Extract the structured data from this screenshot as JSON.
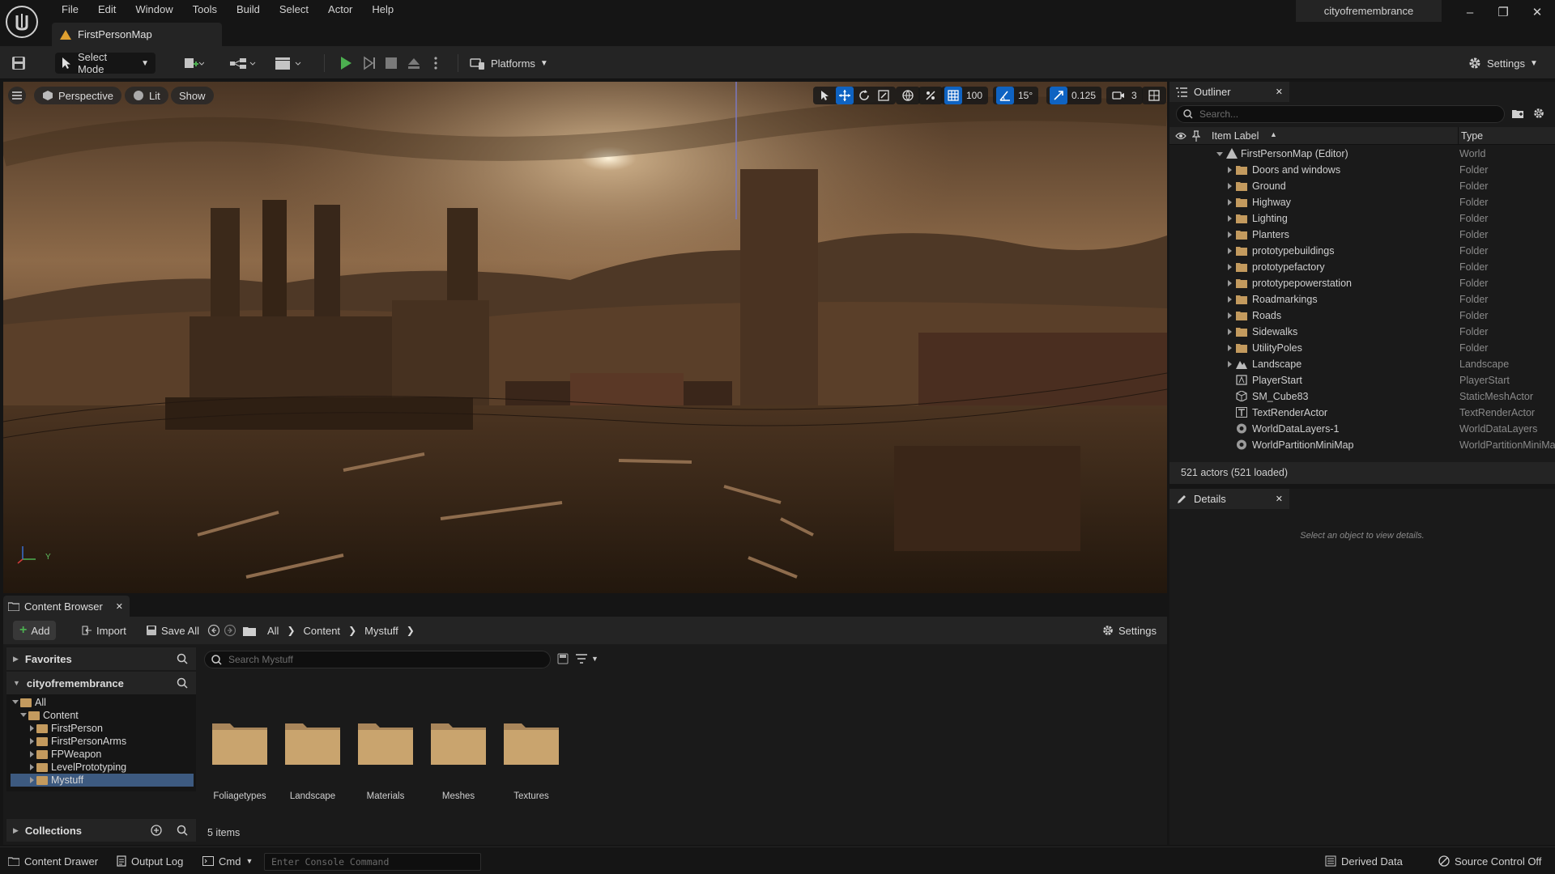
{
  "menu": [
    "File",
    "Edit",
    "Window",
    "Tools",
    "Build",
    "Select",
    "Actor",
    "Help"
  ],
  "map_tab": "FirstPersonMap",
  "project_name": "cityofremembrance",
  "toolbar": {
    "select_mode": "Select Mode",
    "platforms": "Platforms",
    "settings": "Settings"
  },
  "viewport": {
    "perspective": "Perspective",
    "lit": "Lit",
    "show": "Show",
    "grid_snap": "100",
    "rotation_snap": "15°",
    "scale_snap": "0.125",
    "camera_speed": "3",
    "axis_label": "Y"
  },
  "outliner": {
    "tab": "Outliner",
    "search_placeholder": "Search...",
    "col_label": "Item Label",
    "col_type": "Type",
    "rows": [
      {
        "label": "FirstPersonMap (Editor)",
        "type": "World"
      },
      {
        "label": "Doors and windows",
        "type": "Folder"
      },
      {
        "label": "Ground",
        "type": "Folder"
      },
      {
        "label": "Highway",
        "type": "Folder"
      },
      {
        "label": "Lighting",
        "type": "Folder"
      },
      {
        "label": "Planters",
        "type": "Folder"
      },
      {
        "label": "prototypebuildings",
        "type": "Folder"
      },
      {
        "label": "prototypefactory",
        "type": "Folder"
      },
      {
        "label": "prototypepowerstation",
        "type": "Folder"
      },
      {
        "label": "Roadmarkings",
        "type": "Folder"
      },
      {
        "label": "Roads",
        "type": "Folder"
      },
      {
        "label": "Sidewalks",
        "type": "Folder"
      },
      {
        "label": "UtilityPoles",
        "type": "Folder"
      },
      {
        "label": "Landscape",
        "type": "Landscape"
      },
      {
        "label": "PlayerStart",
        "type": "PlayerStart"
      },
      {
        "label": "SM_Cube83",
        "type": "StaticMeshActor"
      },
      {
        "label": "TextRenderActor",
        "type": "TextRenderActor"
      },
      {
        "label": "WorldDataLayers-1",
        "type": "WorldDataLayers"
      },
      {
        "label": "WorldPartitionMiniMap",
        "type": "WorldPartitionMiniMap"
      }
    ],
    "status": "521 actors (521 loaded)"
  },
  "details": {
    "tab": "Details",
    "empty_text": "Select an object to view details."
  },
  "content_browser": {
    "tab": "Content Browser",
    "add": "Add",
    "import": "Import",
    "save_all": "Save All",
    "breadcrumb": [
      "All",
      "Content",
      "Mystuff"
    ],
    "settings": "Settings",
    "favorites": "Favorites",
    "project": "cityofremembrance",
    "tree": [
      {
        "label": "All",
        "depth": 0,
        "expanded": true
      },
      {
        "label": "Content",
        "depth": 1,
        "expanded": true
      },
      {
        "label": "FirstPerson",
        "depth": 2,
        "expanded": false
      },
      {
        "label": "FirstPersonArms",
        "depth": 2,
        "expanded": false
      },
      {
        "label": "FPWeapon",
        "depth": 2,
        "expanded": false
      },
      {
        "label": "LevelPrototyping",
        "depth": 2,
        "expanded": false
      },
      {
        "label": "Mystuff",
        "depth": 2,
        "expanded": false,
        "selected": true
      }
    ],
    "collections": "Collections",
    "search_placeholder": "Search Mystuff",
    "assets": [
      "Foliagetypes",
      "Landscape",
      "Materials",
      "Meshes",
      "Textures"
    ],
    "item_count": "5 items"
  },
  "statusbar": {
    "content_drawer": "Content Drawer",
    "output_log": "Output Log",
    "cmd": "Cmd",
    "console_placeholder": "Enter Console Command",
    "derived_data": "Derived Data",
    "source_control": "Source Control Off"
  }
}
